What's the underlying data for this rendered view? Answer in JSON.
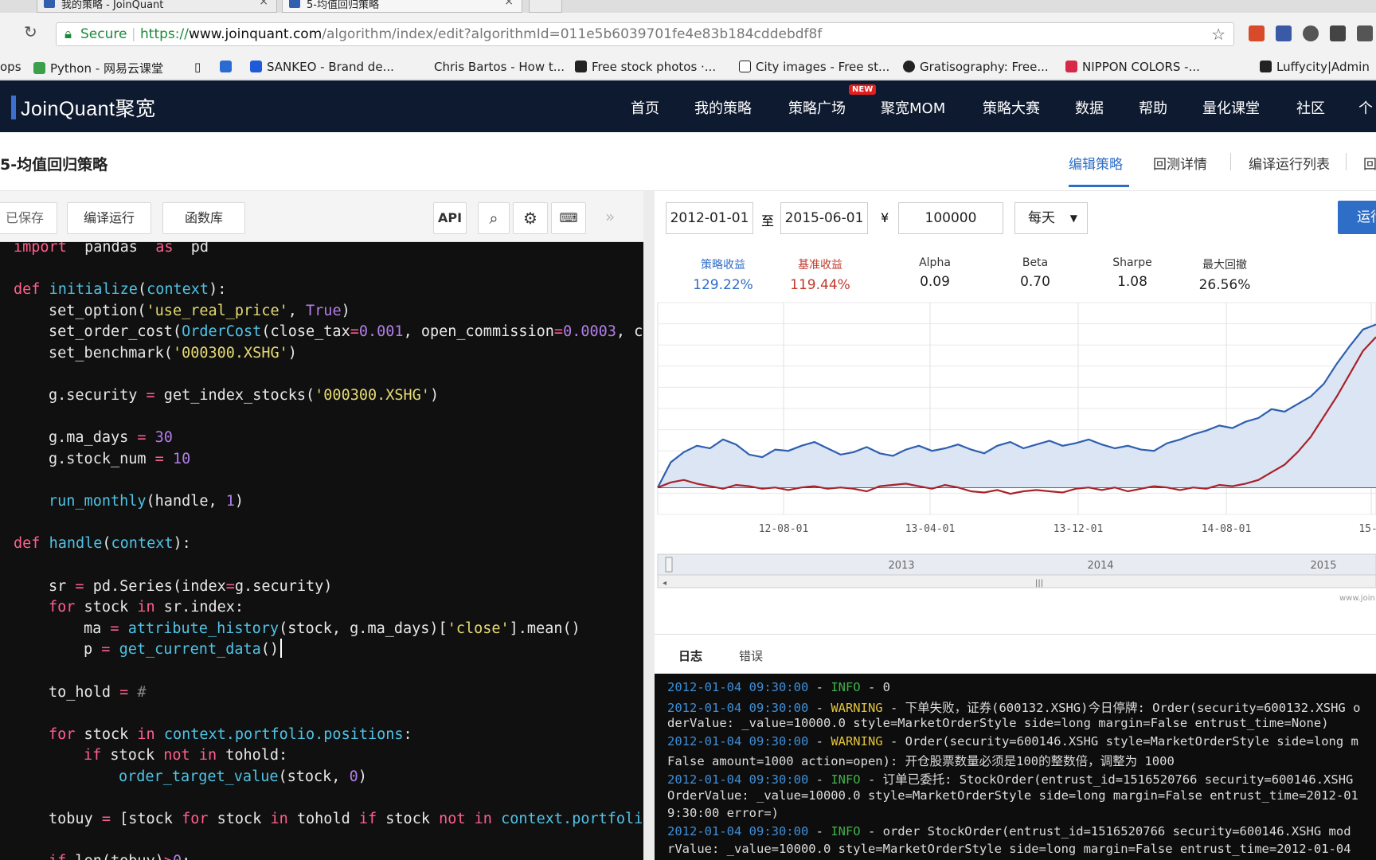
{
  "browser": {
    "tabs": [
      {
        "title": "我的策略 - JoinQuant"
      },
      {
        "title": "5-均值回归策略"
      }
    ],
    "url_secure": "Secure",
    "url_scheme": "https://",
    "url_host": "www.joinquant.com",
    "url_path": "/algorithm/index/edit?algorithmId=011e5b6039701fe4e83b184cddebdf8f",
    "bookmarks": [
      "ops",
      "Python - 网易云课堂",
      "SANKEO - Brand de...",
      "Chris Bartos - How t...",
      "Free stock photos ·...",
      "City images - Free st...",
      "Gratisography: Free...",
      "NIPPON COLORS -...",
      "Luffycity|Admin"
    ]
  },
  "site": {
    "logo": "JoinQuant聚宽",
    "nav": [
      "首页",
      "我的策略",
      "策略广场",
      "聚宽MOM",
      "策略大赛",
      "数据",
      "帮助",
      "量化课堂",
      "社区",
      "个"
    ],
    "new_badge": "NEW"
  },
  "page": {
    "title": "5-均值回归策略",
    "tabs": [
      "编辑策略",
      "回测详情",
      "编译运行列表",
      "回"
    ]
  },
  "editor": {
    "buttons": [
      "已保存",
      "编译运行",
      "函数库",
      "API"
    ],
    "lines": [
      [
        [
          "kw",
          "import"
        ],
        [
          "",
          "  pandas  "
        ],
        [
          "kw",
          "as"
        ],
        [
          "",
          "  pd"
        ]
      ],
      [],
      [
        [
          "kw",
          "def"
        ],
        [
          "",
          " "
        ],
        [
          "fn",
          "initialize"
        ],
        [
          "",
          "("
        ],
        [
          "fn",
          "context"
        ],
        [
          "",
          "):"
        ]
      ],
      [
        [
          "",
          " ",
          "4"
        ],
        [
          "",
          "set_option("
        ],
        [
          "st",
          "'use_real_price'"
        ],
        [
          "",
          ", "
        ],
        [
          "nu",
          "True"
        ],
        [
          "",
          ")"
        ]
      ],
      [
        [
          "",
          "set_order_cost("
        ],
        [
          "fn",
          "OrderCost"
        ],
        [
          "",
          "(close_tax"
        ],
        [
          "op",
          "="
        ],
        [
          "nu",
          "0.001"
        ],
        [
          "",
          ", open_commission"
        ],
        [
          "op",
          "="
        ],
        [
          "nu",
          "0.0003"
        ],
        [
          "",
          ", c"
        ]
      ],
      [
        [
          "",
          "set_benchmark("
        ],
        [
          "st",
          "'000300.XSHG'"
        ],
        [
          "",
          ")"
        ]
      ],
      [],
      [
        [
          "",
          "g.security "
        ],
        [
          "op",
          "="
        ],
        [
          "",
          " get_index_stocks("
        ],
        [
          "st",
          "'000300.XSHG'"
        ],
        [
          "",
          ")"
        ]
      ],
      [],
      [
        [
          "",
          "g.ma_days "
        ],
        [
          "op",
          "="
        ],
        [
          "",
          " "
        ],
        [
          "nu",
          "30"
        ]
      ],
      [
        [
          "",
          "g.stock_num "
        ],
        [
          "op",
          "="
        ],
        [
          "",
          " "
        ],
        [
          "nu",
          "10"
        ]
      ],
      [],
      [
        [
          "fn",
          "run_monthly"
        ],
        [
          "",
          "(handle, "
        ],
        [
          "nu",
          "1"
        ],
        [
          "",
          ")"
        ]
      ],
      [],
      [
        [
          "kw",
          "def"
        ],
        [
          "",
          " "
        ],
        [
          "fn",
          "handle"
        ],
        [
          "",
          "("
        ],
        [
          "fn",
          "context"
        ],
        [
          "",
          "):"
        ]
      ],
      [],
      [
        [
          "",
          "sr "
        ],
        [
          "op",
          "="
        ],
        [
          "",
          " pd.Series(index"
        ],
        [
          "op",
          "="
        ],
        [
          "",
          "g.security)"
        ]
      ],
      [
        [
          "kw",
          "for"
        ],
        [
          "",
          " stock "
        ],
        [
          "kw",
          "in"
        ],
        [
          "",
          " sr.index:"
        ]
      ],
      [
        [
          "",
          "ma "
        ],
        [
          "op",
          "="
        ],
        [
          "",
          " "
        ],
        [
          "fn",
          "attribute_history"
        ],
        [
          "",
          "(stock, g.ma_days)["
        ],
        [
          "st",
          "'close'"
        ],
        [
          "",
          "].mean()"
        ]
      ],
      [
        [
          "",
          "p "
        ],
        [
          "op",
          "="
        ],
        [
          "",
          " "
        ],
        [
          "fn",
          "get_current_data"
        ],
        [
          "",
          "()"
        ]
      ],
      [],
      [
        [
          "",
          "to_hold "
        ],
        [
          "op",
          "="
        ],
        [
          "",
          " "
        ],
        [
          "cm",
          "#"
        ]
      ],
      [],
      [
        [
          "kw",
          "for"
        ],
        [
          "",
          " stock "
        ],
        [
          "kw",
          "in"
        ],
        [
          "",
          " "
        ],
        [
          "fn",
          "context.portfolio.positions"
        ],
        [
          "",
          ":"
        ]
      ],
      [
        [
          "kw",
          "if"
        ],
        [
          "",
          " stock "
        ],
        [
          "kw",
          "not"
        ],
        [
          "",
          " "
        ],
        [
          "kw",
          "in"
        ],
        [
          "",
          " tohold:"
        ]
      ],
      [
        [
          "fn",
          "order_target_value"
        ],
        [
          "",
          "(stock, "
        ],
        [
          "nu",
          "0"
        ],
        [
          "",
          ")"
        ]
      ],
      [],
      [
        [
          "",
          "tobuy "
        ],
        [
          "op",
          "="
        ],
        [
          "",
          " [stock "
        ],
        [
          "kw",
          "for"
        ],
        [
          "",
          " stock "
        ],
        [
          "kw",
          "in"
        ],
        [
          "",
          " tohold "
        ],
        [
          "kw",
          "if"
        ],
        [
          "",
          " stock "
        ],
        [
          "kw",
          "not"
        ],
        [
          "",
          " "
        ],
        [
          "kw",
          "in"
        ],
        [
          "",
          " "
        ],
        [
          "fn",
          "context.portfoli"
        ]
      ],
      [],
      [
        [
          "kw",
          "if"
        ],
        [
          "",
          " len(tobuy)"
        ],
        [
          "op",
          ">"
        ],
        [
          "nu",
          "0"
        ],
        [
          "",
          ":"
        ]
      ]
    ]
  },
  "backtest": {
    "start_date": "2012-01-01",
    "to_label": "至",
    "end_date": "2015-06-01",
    "currency": "¥",
    "capital": "100000",
    "frequency": "每天",
    "run_label": "运行",
    "metrics": [
      {
        "label": "策略收益",
        "value": "129.22%",
        "color": "#2f6ec6"
      },
      {
        "label": "基准收益",
        "value": "119.44%",
        "color": "#c0392b"
      },
      {
        "label": "Alpha",
        "value": "0.09",
        "color": "#222222"
      },
      {
        "label": "Beta",
        "value": "0.70",
        "color": "#222222"
      },
      {
        "label": "Sharpe",
        "value": "1.08",
        "color": "#222222"
      },
      {
        "label": "最大回撤",
        "value": "26.56%",
        "color": "#222222"
      }
    ]
  },
  "chart_data": {
    "type": "line",
    "x_ticks": [
      "12-08-01",
      "13-04-01",
      "13-12-01",
      "14-08-01",
      "15-0"
    ],
    "navigator_years": [
      "2013",
      "2014",
      "2015"
    ],
    "credit": "www.join",
    "series": [
      {
        "name": "策略收益",
        "color": "#2f5fae",
        "values": [
          0,
          20,
          28,
          33,
          31,
          38,
          34,
          26,
          24,
          30,
          29,
          33,
          36,
          31,
          26,
          28,
          32,
          27,
          25,
          30,
          33,
          29,
          31,
          34,
          30,
          27,
          33,
          36,
          31,
          34,
          37,
          33,
          35,
          38,
          34,
          31,
          33,
          30,
          29,
          35,
          38,
          42,
          45,
          49,
          47,
          52,
          55,
          62,
          60,
          66,
          72,
          82,
          98,
          112,
          125,
          129
        ]
      },
      {
        "name": "基准收益",
        "color": "#a8222a",
        "values": [
          0,
          4,
          6,
          3,
          1,
          -1,
          2,
          1,
          -1,
          0,
          -2,
          0,
          1,
          -1,
          0,
          -1,
          -3,
          1,
          2,
          3,
          1,
          -1,
          2,
          0,
          -3,
          -4,
          -2,
          -5,
          -3,
          -2,
          -3,
          -4,
          -1,
          0,
          -2,
          0,
          -3,
          -1,
          1,
          0,
          -2,
          0,
          -1,
          2,
          1,
          3,
          6,
          12,
          18,
          28,
          40,
          56,
          72,
          90,
          108,
          119
        ]
      }
    ],
    "ylim": [
      -15,
      140
    ]
  },
  "log": {
    "tabs": [
      "日志",
      "错误"
    ],
    "lines": [
      [
        [
          "lt",
          "2012-01-04 09:30:00"
        ],
        [
          "",
          " - "
        ],
        [
          "linfo",
          "INFO"
        ],
        [
          "",
          " - 0"
        ]
      ],
      [
        [
          "lt",
          "2012-01-04 09:30:00"
        ],
        [
          "",
          " - "
        ],
        [
          "lwarn",
          "WARNING"
        ],
        [
          "",
          " - 下单失败，证券(600132.XSHG)今日停牌: Order(security=600132.XSHG o"
        ]
      ],
      [
        [
          "",
          "derValue: _value=10000.0 style=MarketOrderStyle side=long margin=False entrust_time=None)"
        ]
      ],
      [
        [
          "lt",
          "2012-01-04 09:30:00"
        ],
        [
          "",
          " - "
        ],
        [
          "lwarn",
          "WARNING"
        ],
        [
          "",
          " - Order(security=600146.XSHG style=MarketOrderStyle side=long m"
        ]
      ],
      [
        [
          "",
          "False amount=1000 action=open): 开仓股票数量必须是100的整数倍，调整为 1000"
        ]
      ],
      [
        [
          "lt",
          "2012-01-04 09:30:00"
        ],
        [
          "",
          " - "
        ],
        [
          "linfo",
          "INFO"
        ],
        [
          "",
          " - 订单已委托: StockOrder(entrust_id=1516520766 security=600146.XSHG"
        ]
      ],
      [
        [
          "",
          "OrderValue: _value=10000.0 style=MarketOrderStyle side=long margin=False entrust_time=2012-01"
        ]
      ],
      [
        [
          "",
          "9:30:00 error=)"
        ]
      ],
      [
        [
          "lt",
          "2012-01-04 09:30:00"
        ],
        [
          "",
          " - "
        ],
        [
          "linfo",
          "INFO"
        ],
        [
          "",
          " - order StockOrder(entrust_id=1516520766 security=600146.XSHG mod"
        ]
      ],
      [
        [
          "",
          "rValue: _value=10000.0 style=MarketOrderStyle side=long margin=False entrust_time=2012-01-04"
        ]
      ]
    ]
  }
}
